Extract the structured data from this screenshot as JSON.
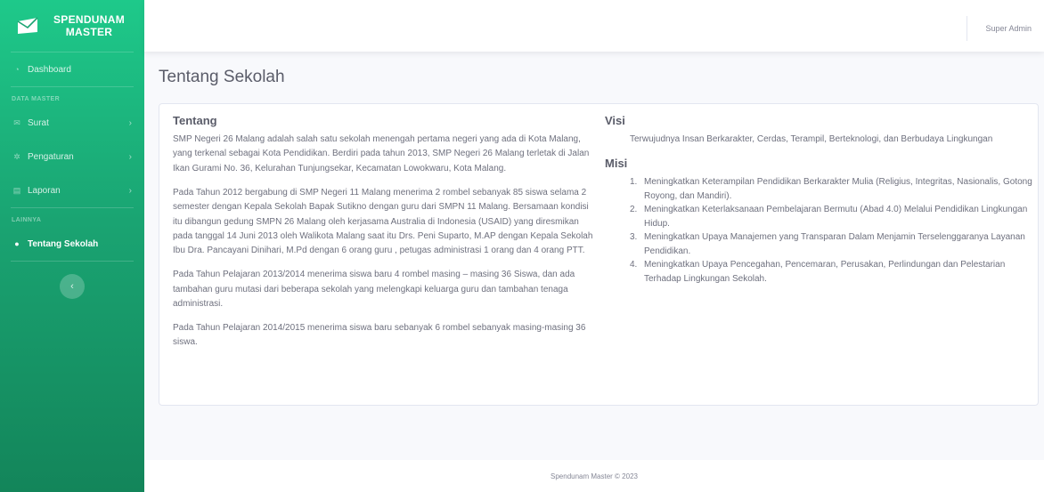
{
  "brand": {
    "line1": "SPENDUNAM",
    "line2": "MASTER"
  },
  "sidebar": {
    "dashboard": "Dashboard",
    "heading_master": "DATA MASTER",
    "items": [
      {
        "label": "Surat",
        "icon": "envelope-icon"
      },
      {
        "label": "Pengaturan",
        "icon": "gear-icon"
      },
      {
        "label": "Laporan",
        "icon": "file-icon"
      }
    ],
    "heading_lainnya": "LAINNYA",
    "active_item": "Tentang Sekolah",
    "toggle_glyph": "‹"
  },
  "topbar": {
    "user": "Super Admin"
  },
  "page": {
    "title": "Tentang Sekolah"
  },
  "tentang": {
    "heading": "Tentang",
    "paragraphs": [
      "SMP Negeri 26 Malang adalah salah satu sekolah menengah pertama negeri yang ada di Kota Malang, yang terkenal sebagai Kota Pendidikan. Berdiri pada tahun 2013, SMP Negeri 26 Malang terletak di Jalan Ikan Gurami No. 36, Kelurahan Tunjungsekar, Kecamatan Lowokwaru, Kota Malang.",
      "Pada Tahun 2012 bergabung di SMP Negeri 11 Malang menerima 2 rombel sebanyak 85 siswa selama 2 semester dengan Kepala Sekolah Bapak Sutikno dengan guru dari SMPN 11 Malang. Bersamaan kondisi itu dibangun gedung SMPN 26 Malang oleh kerjasama Australia di Indonesia (USAID) yang diresmikan pada tanggal 14 Juni 2013 oleh Walikota Malang saat itu Drs. Peni Suparto, M.AP dengan Kepala Sekolah Ibu Dra. Pancayani Dinihari, M.Pd dengan 6 orang guru , petugas administrasi 1 orang dan 4 orang PTT.",
      "Pada Tahun Pelajaran 2013/2014 menerima siswa baru 4 rombel masing – masing 36 Siswa, dan ada tambahan guru mutasi dari beberapa sekolah yang melengkapi keluarga guru dan tambahan tenaga administrasi.",
      "Pada Tahun Pelajaran 2014/2015 menerima siswa baru sebanyak 6 rombel sebanyak masing-masing 36 siswa."
    ]
  },
  "visi": {
    "heading": "Visi",
    "text": "Terwujudnya Insan Berkarakter, Cerdas, Terampil, Berteknologi, dan Berbudaya Lingkungan"
  },
  "misi": {
    "heading": "Misi",
    "items": [
      {
        "num": "1.",
        "text": "Meningkatkan Keterampilan Pendidikan Berkarakter Mulia (Religius, Integritas, Nasionalis, Gotong Royong, dan Mandiri)."
      },
      {
        "num": "2.",
        "text": "Meningkatkan Keterlaksanaan Pembelajaran Bermutu (Abad 4.0) Melalui Pendidikan Lingkungan Hidup."
      },
      {
        "num": "3.",
        "text": "Meningkatkan Upaya Manajemen yang Transparan Dalam Menjamin Terselenggaranya Layanan Pendidikan."
      },
      {
        "num": "4.",
        "text": "Meningkatkan Upaya Pencegahan, Pencemaran, Perusakan, Perlindungan dan Pelestarian Terhadap Lingkungan Sekolah."
      }
    ]
  },
  "footer": {
    "text": "Spendunam Master © 2023"
  },
  "colors": {
    "sidebar_top": "#1ec98a",
    "sidebar_bottom": "#13855a",
    "background": "#f8f9fc"
  }
}
